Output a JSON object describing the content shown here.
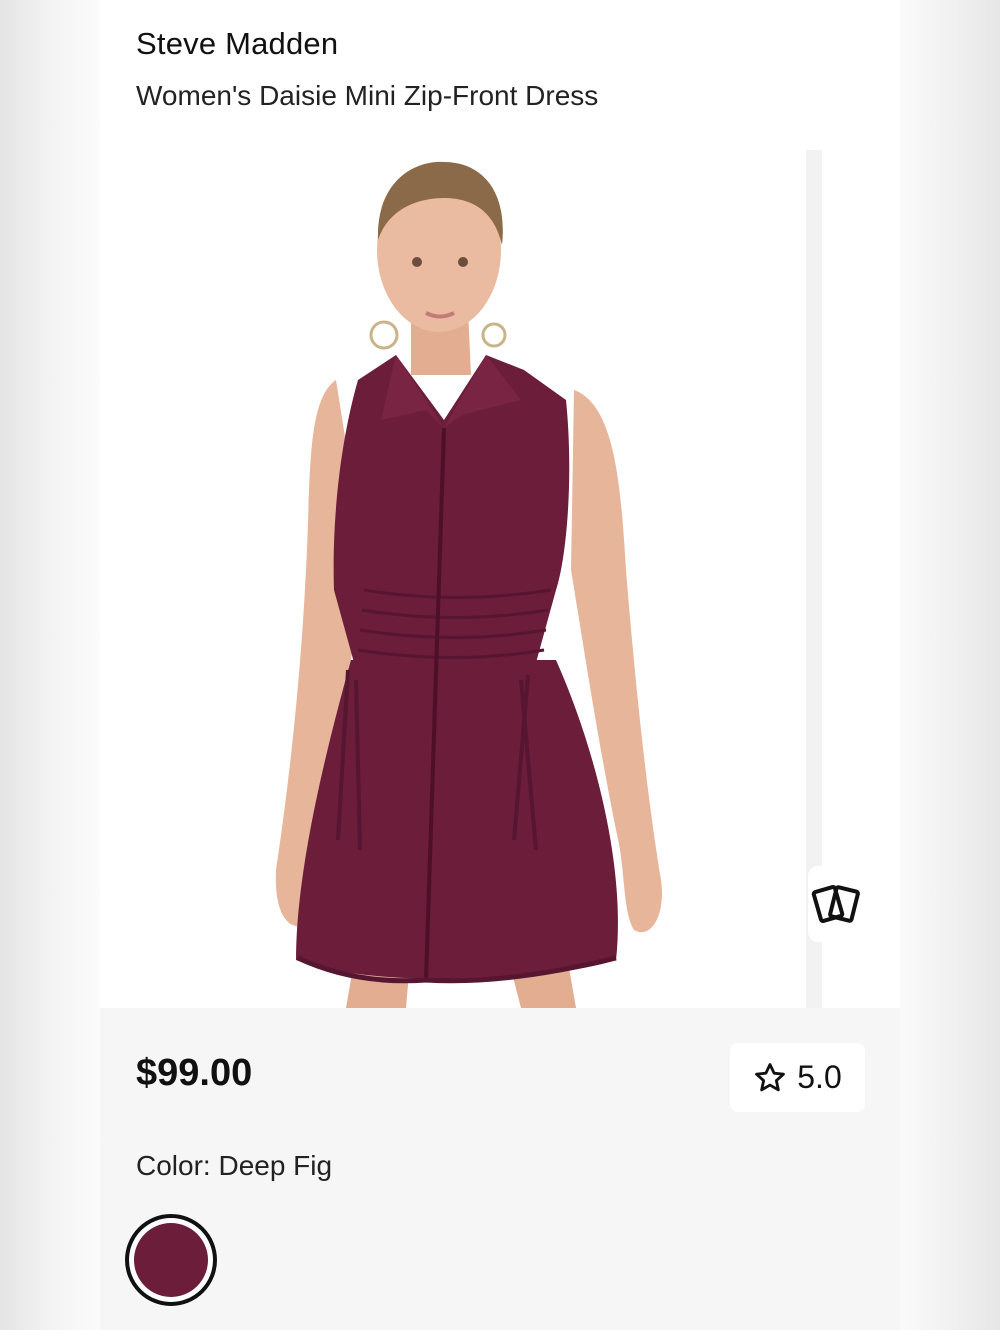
{
  "product": {
    "brand": "Steve Madden",
    "name": "Women's Daisie Mini Zip-Front Dress",
    "price": "$99.00",
    "rating": "5.0",
    "color_label": "Color: Deep Fig"
  },
  "colors": {
    "dress": "#6b1d3a",
    "swatch": "#6b1d3a",
    "skin": "#e6b59a",
    "hair": "#8a6a48"
  },
  "icons": {
    "rating": "star-outline-icon",
    "swipe": "cards-icon"
  }
}
